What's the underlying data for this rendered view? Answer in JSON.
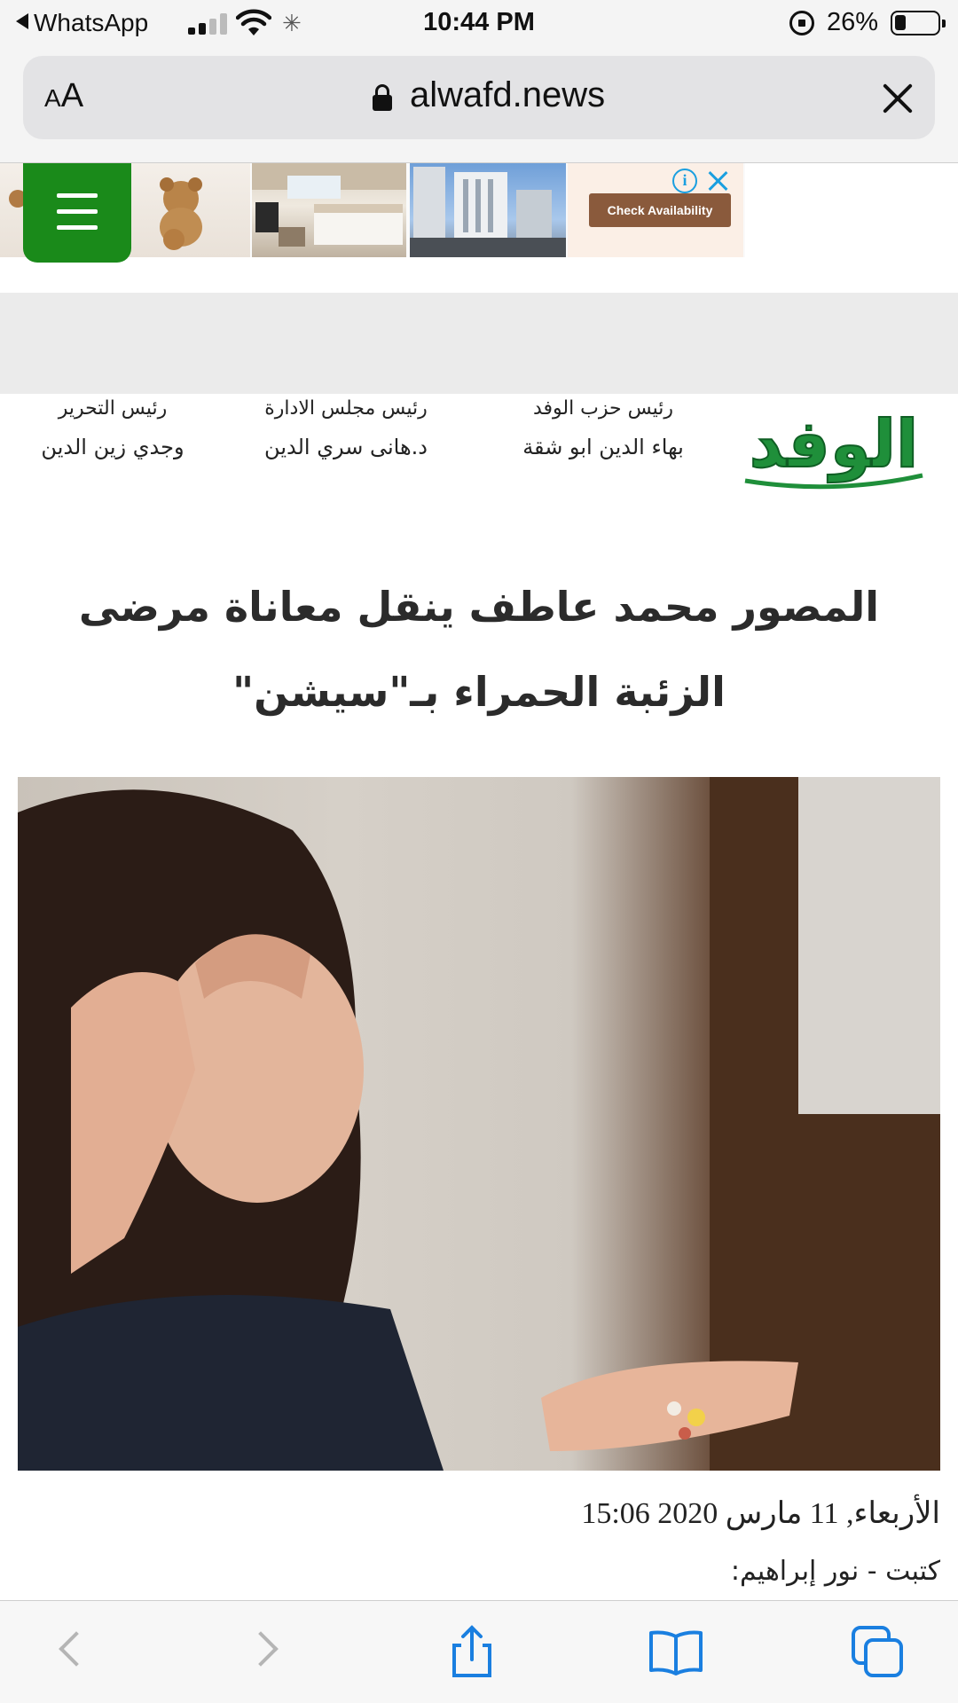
{
  "status_bar": {
    "back_app": "WhatsApp",
    "time": "10:44 PM",
    "battery_percent": "26%",
    "icons": [
      "signal-icon",
      "wifi-icon",
      "loading-icon",
      "orientation-lock-icon",
      "battery-icon"
    ]
  },
  "browser": {
    "text_size_small": "A",
    "text_size_big": "A",
    "url": "alwafd.news"
  },
  "ad": {
    "cta_label": "Check Availability",
    "info_symbol": "i"
  },
  "masthead": {
    "logo_text": "الوفد",
    "columns": [
      {
        "role": "رئيس حزب الوفد",
        "name": "بهاء الدين ابو شقة"
      },
      {
        "role": "رئيس مجلس الادارة",
        "name": "د.هانى سري الدين"
      },
      {
        "role": "رئيس التحرير",
        "name": "وجدي زين الدين"
      }
    ]
  },
  "article": {
    "headline": "المصور محمد عاطف ينقل معاناة مرضى الزئبة الحمراء بـ\"سيشن\"",
    "date": "الأربعاء, 11 مارس 2020 15:06",
    "author": "كتبت - نور إبراهيم:"
  },
  "colors": {
    "brand_green": "#1a8a1a",
    "ios_blue": "#1a7fe0",
    "ad_accent": "#1a9fe0"
  }
}
